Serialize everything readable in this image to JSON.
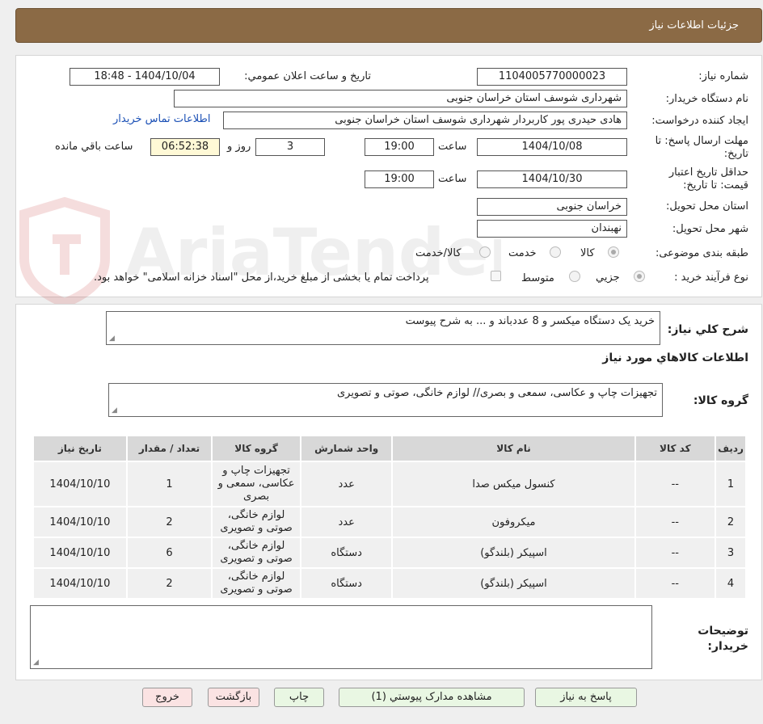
{
  "header": {
    "title": "جزئیات اطلاعات نیاز"
  },
  "watermark": {
    "text": "AriaTender.neT"
  },
  "form": {
    "need_number_label": "شماره نیاز:",
    "need_number": "1104005770000023",
    "announce_label": "تاریخ و ساعت اعلان عمومي:",
    "announce_value": "1404/10/04 - 18:48",
    "buyer_org_label": "نام دستگاه خریدار:",
    "buyer_org": "شهرداری شوسف استان خراسان جنوبی",
    "creator_label": "ایجاد کننده درخواست:",
    "creator": "هادی حیدری پور کاربردار شهرداری شوسف استان خراسان جنوبی",
    "contact_link": "اطلاعات تماس خریدار",
    "deadline_label": "مهلت ارسال پاسخ: تا تاریخ:",
    "deadline_date": "1404/10/08",
    "time_label": "ساعت",
    "deadline_time": "19:00",
    "days_value": "3",
    "days_label": "روز و",
    "remaining_time": "06:52:38",
    "remaining_label": "ساعت باقي مانده",
    "validity_label": "حداقل تاریخ اعتبار قیمت: تا تاریخ:",
    "validity_date": "1404/10/30",
    "validity_time": "19:00",
    "province_label": "استان محل تحویل:",
    "province": "خراسان جنوبی",
    "city_label": "شهر محل تحویل:",
    "city": "نهبندان",
    "category_label": "طبقه بندی موضوعی:",
    "category_options": [
      "کالا",
      "خدمت",
      "کالا/خدمت"
    ],
    "process_label": "نوع فرآیند خرید :",
    "process_options": [
      "جزیي",
      "متوسط"
    ],
    "payment_note": "پرداخت تمام یا بخشی از مبلغ خرید،از محل \"اسناد خزانه اسلامی\" خواهد بود."
  },
  "summary": {
    "label": "شرح کلي نیاز:",
    "value": "خرید یک دستگاه میکسر و 8 عددباند و ... به شرح پیوست"
  },
  "goods": {
    "section_title": "اطلاعات کالاهاي مورد نیاز",
    "group_label": "گروه کالا:",
    "group_value": "تجهیزات چاپ و عکاسی، سمعی و بصری// لوازم خانگی، صوتی و تصویری",
    "columns": [
      "ردیف",
      "کد کالا",
      "نام کالا",
      "واحد شمارش",
      "گروه کالا",
      "تعداد / مقدار",
      "تاریخ نیاز"
    ],
    "rows": [
      {
        "row": "1",
        "code": "--",
        "name": "کنسول میکس صدا",
        "unit": "عدد",
        "group": "تجهیزات چاپ و عکاسی، سمعی و بصری",
        "qty": "1",
        "date": "1404/10/10"
      },
      {
        "row": "2",
        "code": "--",
        "name": "میکروفون",
        "unit": "عدد",
        "group": "لوازم خانگی، صوتی و تصویری",
        "qty": "2",
        "date": "1404/10/10"
      },
      {
        "row": "3",
        "code": "--",
        "name": "اسپیکر (بلندگو)",
        "unit": "دستگاه",
        "group": "لوازم خانگی، صوتی و تصویری",
        "qty": "6",
        "date": "1404/10/10"
      },
      {
        "row": "4",
        "code": "--",
        "name": "اسپیکر (بلندگو)",
        "unit": "دستگاه",
        "group": "لوازم خانگی، صوتی و تصویری",
        "qty": "2",
        "date": "1404/10/10"
      }
    ]
  },
  "notes": {
    "label": "توضیحات خریدار:",
    "value": ""
  },
  "buttons": {
    "reply": "پاسخ به نیاز",
    "attachments": "مشاهده مدارک پیوستي (1)",
    "print": "چاپ",
    "back": "بازگشت",
    "exit": "خروج"
  }
}
